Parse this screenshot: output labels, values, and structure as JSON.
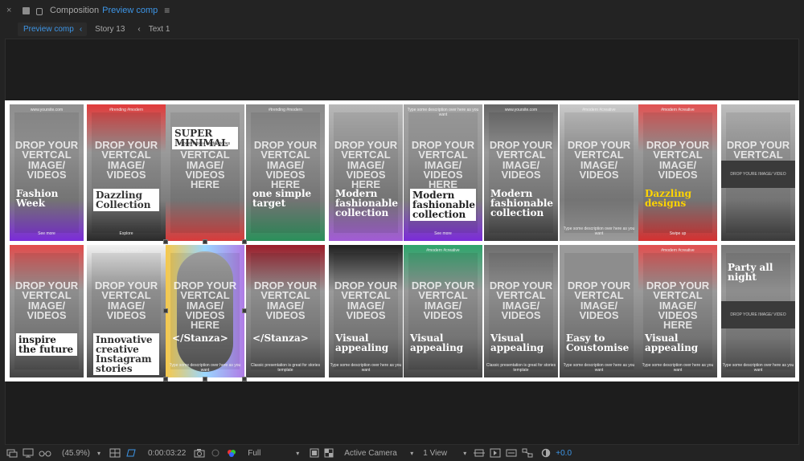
{
  "window": {
    "close_glyph": "×",
    "panel_label": "Composition",
    "comp_name": "Preview comp",
    "menu_glyph": "≡"
  },
  "navbar": {
    "active": "Preview comp",
    "items": [
      "Story 13",
      "Text 1"
    ]
  },
  "tiles_row1": [
    {
      "drop": "DROP YOUR VERTCAL IMAGE/ VIDEOS",
      "caption": "Fashion Week",
      "footer": "See more",
      "top": "www.yoursite.com"
    },
    {
      "drop": "DROP YOUR VERTCAL IMAGE/ VIDEOS",
      "caption": "Dazzling Collection",
      "footer": "Explore",
      "top": "#trending #modern"
    },
    {
      "drop": "DROP YOUR VERTCAL IMAGE/ VIDEOS HERE",
      "caption": "SUPER MINIMAL",
      "sub": "modern social media stories"
    },
    {
      "drop": "DROP YOUR VERTCAL IMAGE/ VIDEOS HERE",
      "caption": "one simple target",
      "top": "#trending #modern"
    },
    {
      "drop": "DROP YOUR VERTCAL IMAGE/ VIDEOS HERE",
      "caption": "Modern fashionable collection"
    },
    {
      "drop": "DROP YOUR VERTCAL IMAGE/ VIDEOS HERE",
      "caption": "Modern fashionable collection",
      "footer": "See more",
      "top": "Type some description over here as you want"
    },
    {
      "drop": "DROP YOUR VERTCAL IMAGE/ VIDEOS",
      "caption": "Modern fashionable collection",
      "top": "www.yoursite.com"
    },
    {
      "drop": "DROP YOUR VERTCAL IMAGE/ VIDEOS",
      "caption": "",
      "top": "#modern #creative",
      "footer": "Type some description over here as you want"
    },
    {
      "drop": "DROP YOUR VERTCAL IMAGE/ VIDEOS",
      "caption": "Dazzling designs",
      "footer": "Swipe up",
      "top": "#modern #creative"
    },
    {
      "drop": "DROP YOUR VERTCAL IMAGE/ VIDEOS",
      "caption": "",
      "mid": "DROP YOURE IMAGE/ VIDEO"
    }
  ],
  "tiles_row2": [
    {
      "drop": "DROP YOUR VERTCAL IMAGE/ VIDEOS",
      "caption": "inspire the future"
    },
    {
      "drop": "DROP YOUR VERTCAL IMAGE/ VIDEOS",
      "caption": "Innovative creative Instagram stories",
      "top": "#modern #creative"
    },
    {
      "drop": "DROP YOUR VERTCAL IMAGE/ VIDEOS HERE",
      "caption": "</Stanza>",
      "footer": "Type some description over here as you want"
    },
    {
      "drop": "DROP YOUR VERTCAL IMAGE/ VIDEOS",
      "caption": "</Stanza>",
      "footer": "Classic presentation is great for stories template"
    },
    {
      "drop": "DROP YOUR VERTCAL IMAGE/ VIDEOS",
      "caption": "Visual appealing",
      "footer": "Type some description over here as you want"
    },
    {
      "drop": "DROP YOUR VERTCAL IMAGE/ VIDEOS",
      "caption": "Visual appealing",
      "top": "#modern #creative"
    },
    {
      "drop": "DROP YOUR VERTCAL IMAGE/ VIDEOS",
      "caption": "Visual appealing",
      "footer": "Classic presentation is great for stories template"
    },
    {
      "drop": "DROP YOUR VERTCAL IMAGE/ VIDEOS",
      "caption": "Easy to Coustomise",
      "footer": "Type some description over here as you want"
    },
    {
      "drop": "DROP YOUR VERTCAL IMAGE/ VIDEOS HERE",
      "caption": "Visual appealing",
      "top": "#modern #creative",
      "footer": "Type some description over here as you want"
    },
    {
      "drop": "",
      "caption": "Party all night",
      "mid": "DROP YOURE IMAGE/ VIDEO",
      "footer": "Type some description over here as you want"
    }
  ],
  "bottombar": {
    "zoom": "(45.9%)",
    "timecode": "0:00:03:22",
    "resolution": "Full",
    "camera": "Active Camera",
    "views": "1 View",
    "exposure": "+0.0"
  },
  "colors": {
    "accent": "#3d95e6",
    "panel_bg": "#232323",
    "viewer_bg": "#1d1d1d"
  }
}
